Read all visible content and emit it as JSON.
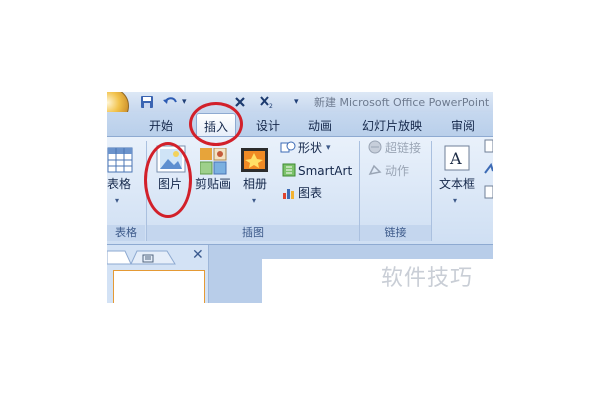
{
  "window": {
    "title": "新建 Microsoft Office PowerPoint"
  },
  "quick_access": {
    "undo_icon": "undo-icon",
    "save_icon": "save-icon"
  },
  "tabs": [
    {
      "label": "开始",
      "active": false
    },
    {
      "label": "插入",
      "active": true
    },
    {
      "label": "设计",
      "active": false
    },
    {
      "label": "动画",
      "active": false
    },
    {
      "label": "幻灯片放映",
      "active": false
    },
    {
      "label": "审阅",
      "active": false
    }
  ],
  "ribbon": {
    "tables": {
      "button_label": "表格",
      "group_label": "表格"
    },
    "illustrations": {
      "picture_label": "图片",
      "clipart_label": "剪贴画",
      "album_label": "相册",
      "shapes_label": "形状",
      "smartart_label": "SmartArt",
      "chart_label": "图表",
      "group_label": "插图"
    },
    "links": {
      "hyperlink_label": "超链接",
      "action_label": "动作",
      "group_label": "链接"
    },
    "text": {
      "textbox_label": "文本框"
    }
  },
  "watermark": "软件技巧",
  "colors": {
    "highlight_circle": "#d2202a",
    "ribbon": "#dbe7f6"
  }
}
